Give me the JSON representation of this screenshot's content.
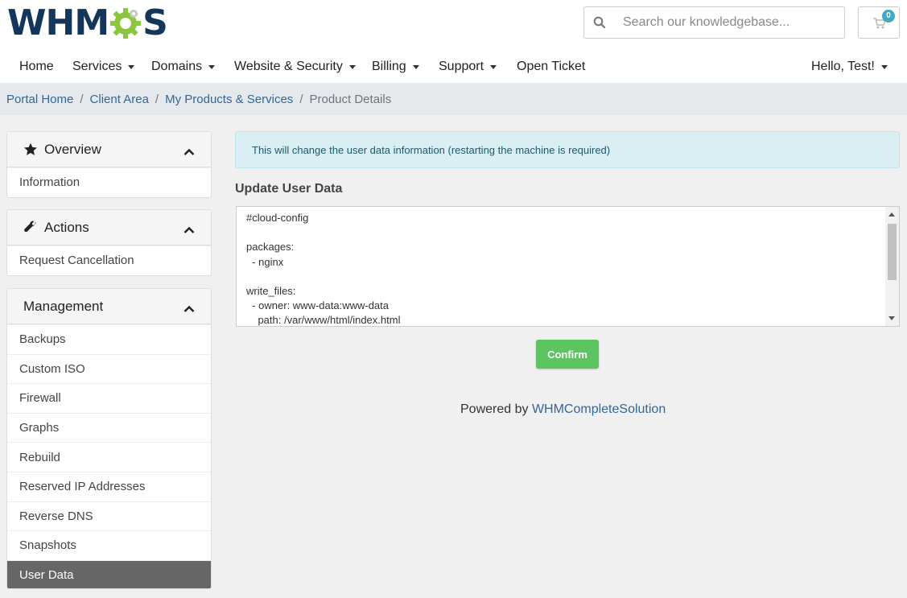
{
  "brand": {
    "logo_text_left": "WHM",
    "logo_text_right": "S",
    "accent": "#8cc63f",
    "navy": "#13365a"
  },
  "search": {
    "placeholder": "Search our knowledgebase..."
  },
  "cart": {
    "count": "0"
  },
  "nav": {
    "items": [
      {
        "label": "Home",
        "dropdown": false
      },
      {
        "label": "Services",
        "dropdown": true
      },
      {
        "label": "Domains",
        "dropdown": true
      },
      {
        "label": "Website & Security",
        "dropdown": true
      },
      {
        "label": "Billing",
        "dropdown": true
      },
      {
        "label": "Support",
        "dropdown": true
      },
      {
        "label": "Open Ticket",
        "dropdown": false
      }
    ],
    "user": "Hello, Test!"
  },
  "breadcrumb": {
    "links": [
      "Portal Home",
      "Client Area",
      "My Products & Services"
    ],
    "current": "Product Details",
    "separator": "/"
  },
  "sidebar": {
    "overview": {
      "title": "Overview",
      "icon": "star-icon",
      "items": [
        "Information"
      ]
    },
    "actions": {
      "title": "Actions",
      "icon": "wrench-icon",
      "items": [
        "Request Cancellation"
      ]
    },
    "management": {
      "title": "Management",
      "items": [
        "Backups",
        "Custom ISO",
        "Firewall",
        "Graphs",
        "Rebuild",
        "Reserved IP Addresses",
        "Reverse DNS",
        "Snapshots",
        "User Data"
      ],
      "active": "User Data"
    }
  },
  "main": {
    "alert": "This will change the user data information (restarting the machine is required)",
    "section_title": "Update User Data",
    "user_data": "#cloud-config\n\npackages:\n  - nginx\n\nwrite_files:\n  - owner: www-data:www-data\n    path: /var/www/html/index.html",
    "confirm_label": "Confirm"
  },
  "footer": {
    "prefix": "Powered by ",
    "link": "WHMCompleteSolution"
  }
}
